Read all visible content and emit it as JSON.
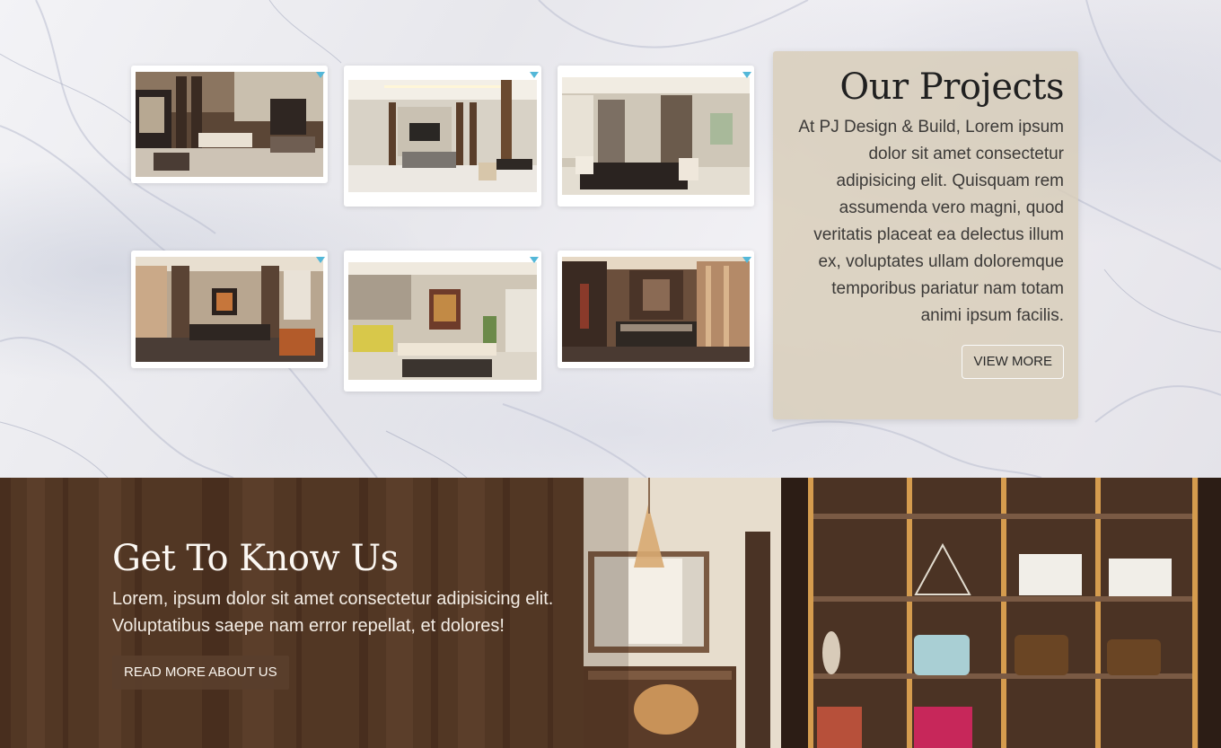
{
  "projects": {
    "title": "Our Projects",
    "description": "At PJ Design & Build, Lorem ipsum dolor sit amet consectetur adipisicing elit. Quisquam rem assumenda vero magni, quod veritatis placeat ea delectus illum ex, voluptates ullam doloremque temporibus pariatur nam totam animi ipsum facilis.",
    "view_more_label": "VIEW MORE",
    "gallery": [
      {
        "name": "living-dining-double-height"
      },
      {
        "name": "living-room-tv-wall"
      },
      {
        "name": "dining-area"
      },
      {
        "name": "lounge-ceiling-fan"
      },
      {
        "name": "kitchen-dining"
      },
      {
        "name": "master-bedroom"
      }
    ]
  },
  "about": {
    "title": "Get To Know Us",
    "description": "Lorem, ipsum dolor sit amet consectetur adipisicing elit. Voluptatibus saepe nam error repellat, et dolores!",
    "read_more_label": "READ MORE ABOUT US"
  },
  "colors": {
    "card_bg": "#d8cdb8",
    "read_more_bg": "#5a3e2c",
    "thumb_corner": "#53b7d8"
  }
}
